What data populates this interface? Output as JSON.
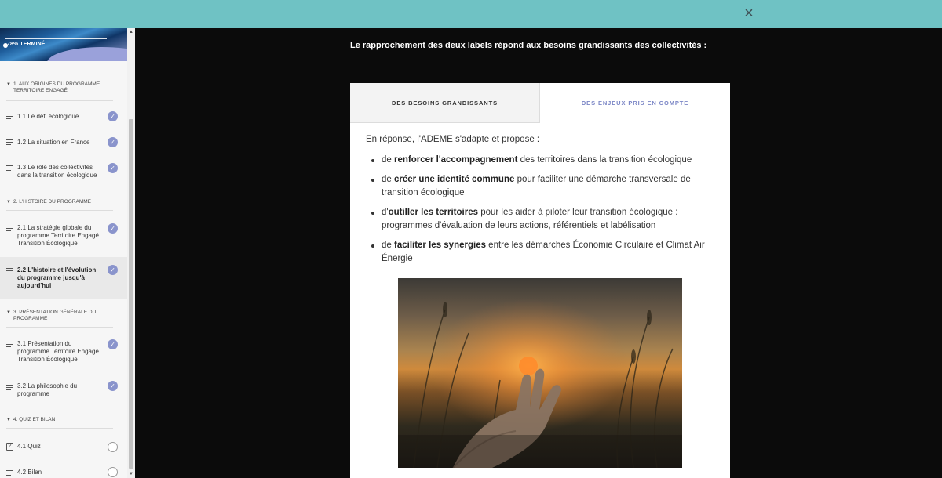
{
  "topbar": {
    "close_icon": "×"
  },
  "sidebar": {
    "progress_text": "78% TERMINÉ",
    "sections": [
      {
        "title": "1. AUX ORIGINES DU PROGRAMME TERRITOIRE ENGAGÉ"
      },
      {
        "title": "2. L'HISTOIRE DU PROGRAMME"
      },
      {
        "title": "3. PRÉSENTATION GÉNÉRALE DU PROGRAMME"
      },
      {
        "title": "4. QUIZ ET BILAN"
      }
    ],
    "lessons": [
      {
        "label": "1.1 Le défi écologique",
        "status": "complete"
      },
      {
        "label": "1.2 La situation en France",
        "status": "complete"
      },
      {
        "label": "1.3 Le rôle des collectivités dans la transition écologique",
        "status": "complete"
      },
      {
        "label": "2.1 La stratégie globale du programme Territoire Engagé Transition Écologique",
        "status": "complete"
      },
      {
        "label": "2.2 L'histoire et l'évolution du programme jusqu'à aujourd'hui",
        "status": "complete",
        "active": true
      },
      {
        "label": "3.1 Présentation du programme Territoire Engagé Transition Écologique",
        "status": "complete"
      },
      {
        "label": "3.2 La philosophie du programme",
        "status": "complete"
      },
      {
        "label": "4.1 Quiz",
        "status": "incomplete"
      },
      {
        "label": "4.2 Bilan",
        "status": "incomplete"
      }
    ],
    "check_glyph": "✓",
    "quiz_glyph": "?"
  },
  "main": {
    "intro": "Le rapprochement des deux labels répond aux besoins grandissants des collectivités :",
    "tabs": [
      {
        "label": "DES BESOINS GRANDISSANTS",
        "selected": false
      },
      {
        "label": "DES ENJEUX PRIS EN COMPTE",
        "selected": true
      }
    ],
    "panel": {
      "lead": "En réponse, l'ADEME s'adapte et propose :",
      "bullets": [
        {
          "pre": "de ",
          "bold": "renforcer l'accompagnement",
          "post": " des territoires dans la transition écologique"
        },
        {
          "pre": "de ",
          "bold": "créer une identité commune",
          "post": " pour faciliter une démarche transversale de transition écologique"
        },
        {
          "pre": "d'",
          "bold": "outiller les territoires",
          "post": " pour les aider à piloter leur transition écologique : programmes d'évaluation de leurs actions, référentiels et labélisation"
        },
        {
          "pre": "de ",
          "bold": "faciliter les synergies",
          "post": " entre les démarches Économie Circulaire et Climat Air Énergie"
        }
      ]
    }
  },
  "colors": {
    "topbar": "#6fc2c4",
    "accent": "#7b86c6",
    "check": "#8a94cc",
    "background": "#0b0b0b"
  }
}
